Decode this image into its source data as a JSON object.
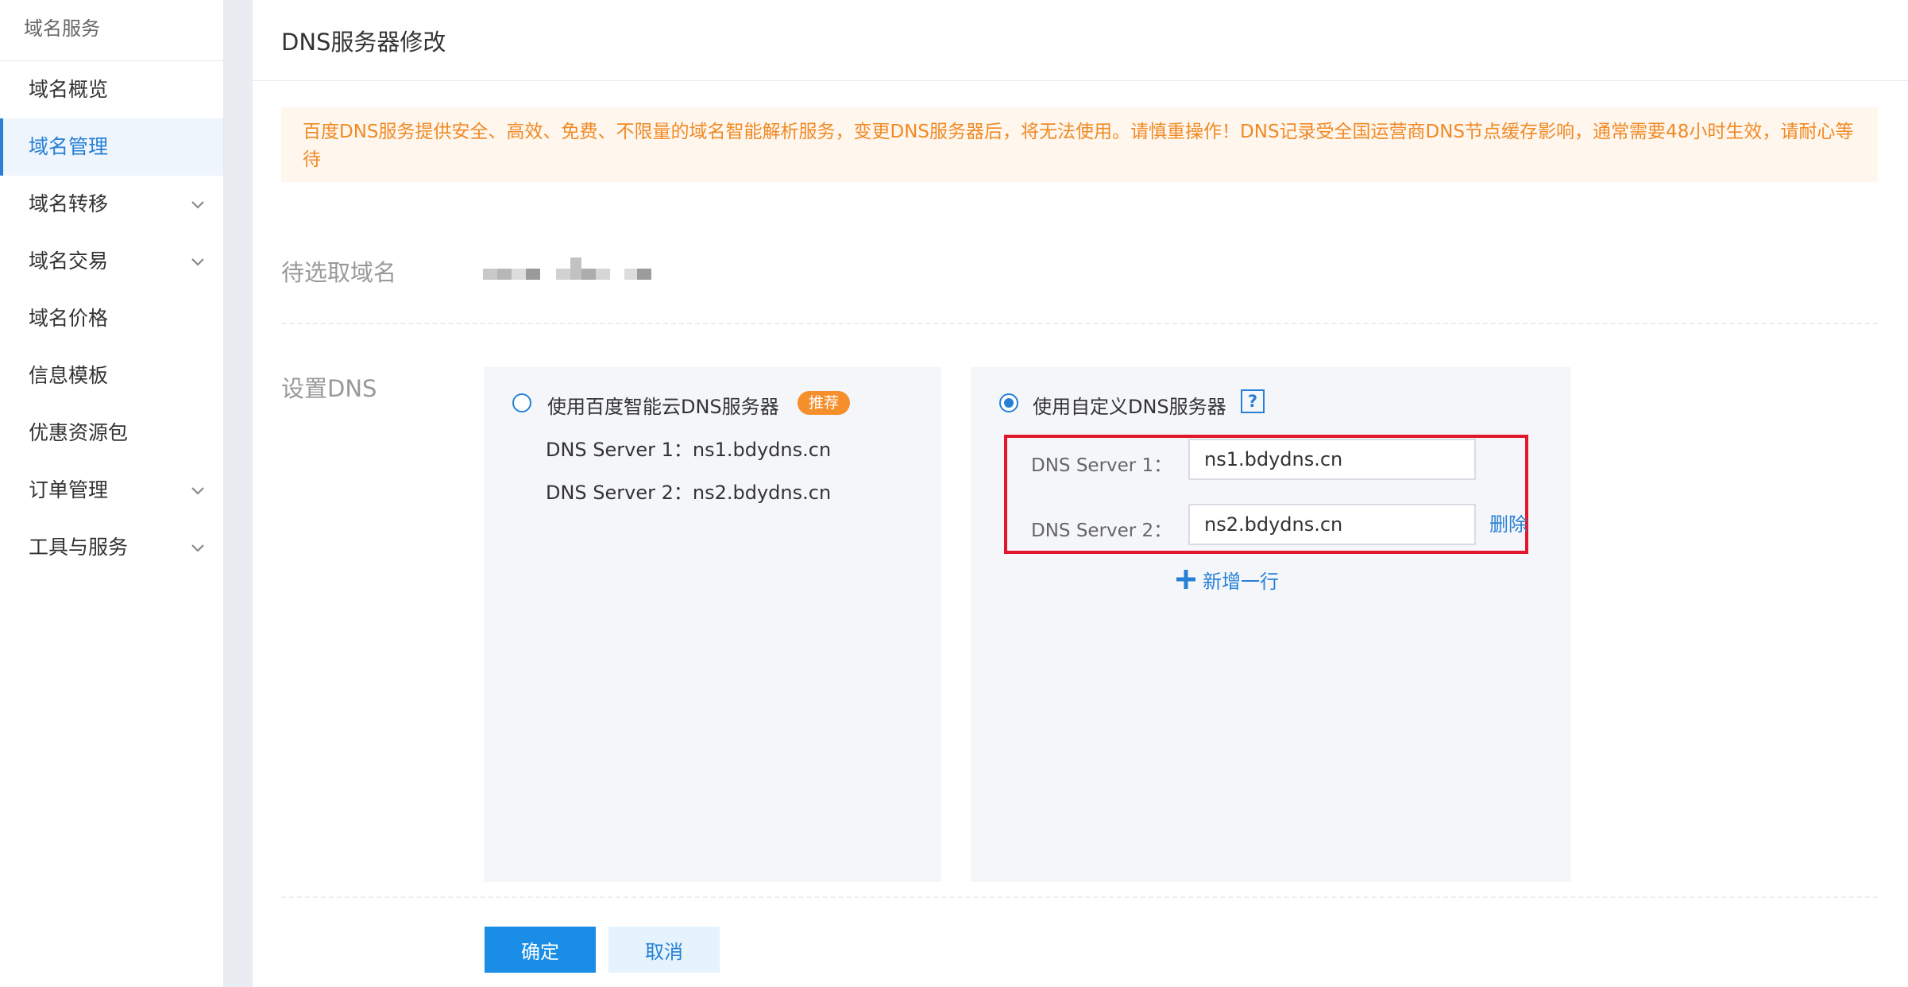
{
  "sidebar": {
    "title": "域名服务",
    "items": [
      {
        "label": "域名概览",
        "active": false,
        "expandable": false
      },
      {
        "label": "域名管理",
        "active": true,
        "expandable": false
      },
      {
        "label": "域名转移",
        "active": false,
        "expandable": true
      },
      {
        "label": "域名交易",
        "active": false,
        "expandable": true
      },
      {
        "label": "域名价格",
        "active": false,
        "expandable": false
      },
      {
        "label": "信息模板",
        "active": false,
        "expandable": false
      },
      {
        "label": "优惠资源包",
        "active": false,
        "expandable": false
      },
      {
        "label": "订单管理",
        "active": false,
        "expandable": true
      },
      {
        "label": "工具与服务",
        "active": false,
        "expandable": true
      }
    ]
  },
  "page": {
    "title": "DNS服务器修改",
    "notice": "百度DNS服务提供安全、高效、免费、不限量的域名智能解析服务，变更DNS服务器后，将无法使用。请慎重操作！DNS记录受全国运营商DNS节点缓存影响，通常需要48小时生效，请耐心等待"
  },
  "domain_row": {
    "label": "待选取域名"
  },
  "dns_row": {
    "label": "设置DNS",
    "baidu_option": {
      "title": "使用百度智能云DNS服务器",
      "badge": "推荐",
      "selected": false,
      "server1": "DNS Server 1：ns1.bdydns.cn",
      "server2": "DNS Server 2：ns2.bdydns.cn"
    },
    "custom_option": {
      "title": "使用自定义DNS服务器",
      "help": "?",
      "selected": true,
      "server1_label": "DNS Server 1：",
      "server1_value": "ns1.bdydns.cn",
      "server2_label": "DNS Server 2：",
      "server2_value": "ns2.bdydns.cn",
      "delete_label": "删除",
      "add_row_label": "新增一行"
    }
  },
  "actions": {
    "confirm": "确定",
    "cancel": "取消"
  },
  "colors": {
    "accent": "#2780d6",
    "primary_button": "#1a8de6",
    "notice_text": "#f08a24",
    "notice_bg": "#fff6ee",
    "badge": "#f58f2c",
    "highlight_border": "#e3172b"
  }
}
